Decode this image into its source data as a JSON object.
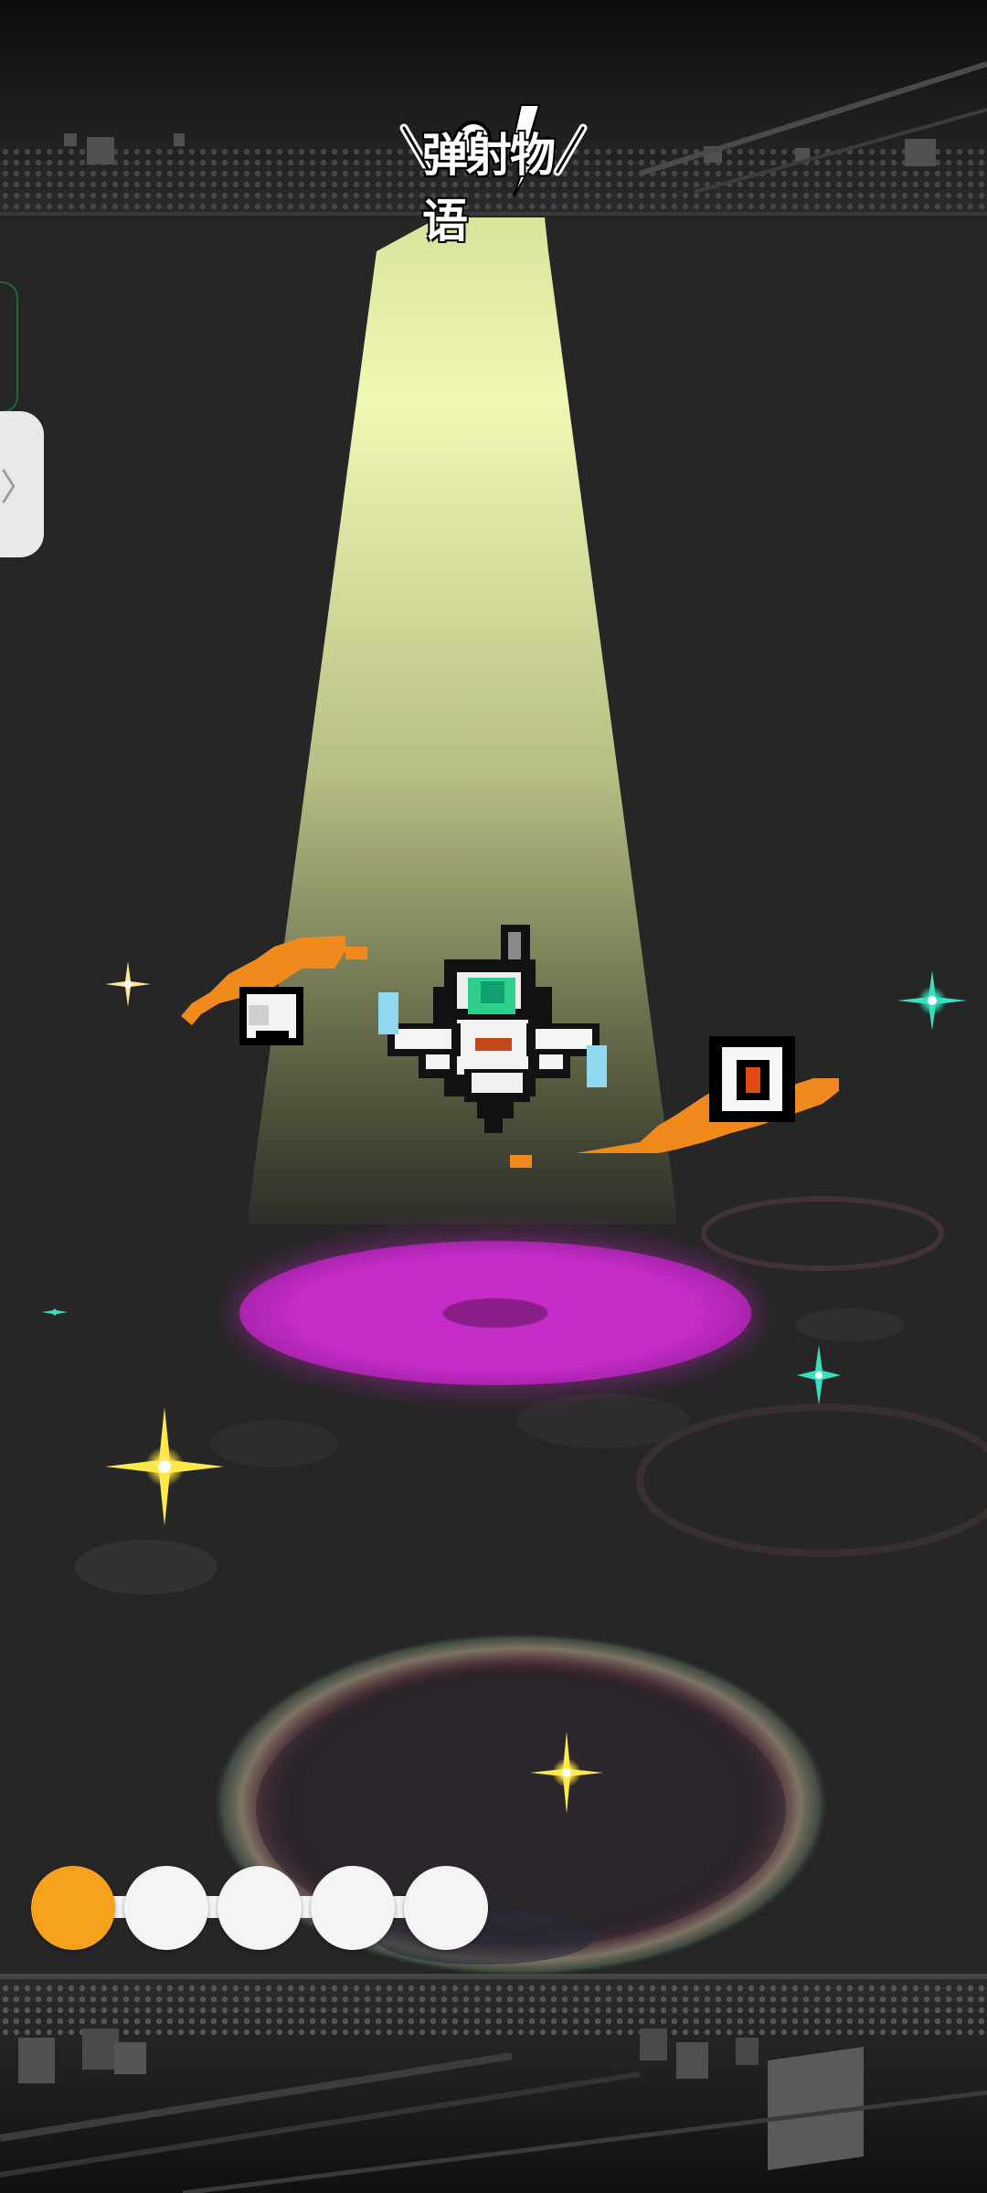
{
  "app": {
    "logo_text": "弹射物语",
    "logo_icon": "game-logo-icon"
  },
  "sidebar": {
    "toggle_icon": "chevron-right-icon",
    "toggle_glyph": "〉"
  },
  "scene": {
    "character": "pixel-robot-character",
    "companions": [
      "orange-tail-orb-left",
      "orange-tail-eye-orb-right"
    ],
    "pad_color": "#c62cc8",
    "spotlight_color": "#f2f8b8",
    "sparkle_colors": [
      "#ffe84a",
      "#36e0c0"
    ]
  },
  "pager": {
    "total_pages": 5,
    "current_page": 1,
    "active_color": "#f7a21c",
    "inactive_color": "#f4f4f4"
  }
}
